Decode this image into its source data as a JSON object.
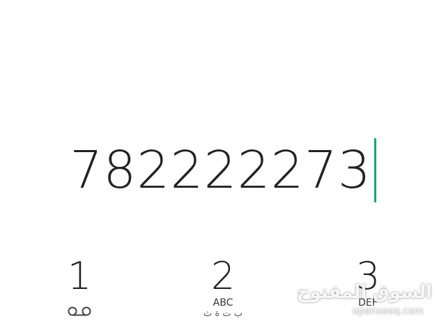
{
  "dialer": {
    "number": "782222273",
    "cursor_color": "#1aa871"
  },
  "keypad": {
    "keys": [
      {
        "digit": "1",
        "letters": "",
        "arabic": "",
        "icon": "voicemail-icon"
      },
      {
        "digit": "2",
        "letters": "ABC",
        "arabic": "ب ت ة ث"
      },
      {
        "digit": "3",
        "letters": "DEF",
        "arabic": ""
      }
    ]
  },
  "watermark": {
    "arabic": "السوق المفتوح",
    "latin": "opensooq.com"
  }
}
